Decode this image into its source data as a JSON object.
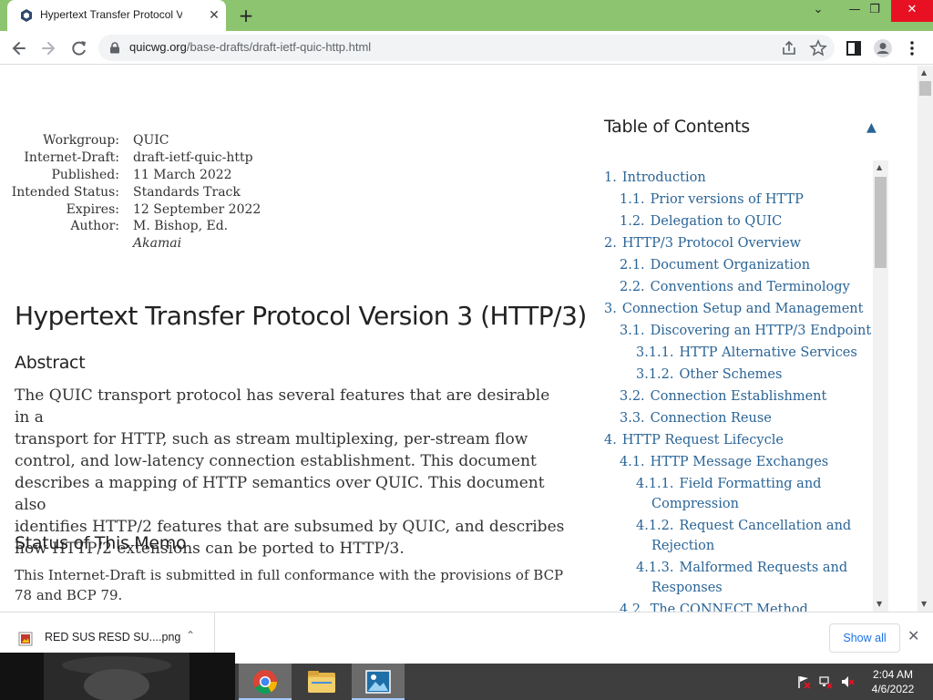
{
  "browser": {
    "tab_title": "Hypertext Transfer Protocol Versi",
    "url_domain": "quicwg.org",
    "url_path": "/base-drafts/draft-ietf-quic-http.html"
  },
  "document": {
    "meta": [
      {
        "label": "Workgroup:",
        "value": "QUIC"
      },
      {
        "label": "Internet-Draft:",
        "value": "draft-ietf-quic-http"
      },
      {
        "label": "Published:",
        "value": "11 March 2022"
      },
      {
        "label": "Intended Status:",
        "value": "Standards Track"
      },
      {
        "label": "Expires:",
        "value": "12 September 2022"
      },
      {
        "label": "Author:",
        "value": "M. Bishop, Ed."
      }
    ],
    "author_org": "Akamai",
    "title": "Hypertext Transfer Protocol Version 3 (HTTP/3)",
    "abstract_heading": "Abstract",
    "abstract_lines": [
      "The QUIC transport protocol has several features that are desirable in a",
      "transport for HTTP, such as stream multiplexing, per-stream flow",
      "control, and low-latency connection establishment. This document",
      "describes a mapping of HTTP semantics over QUIC. This document also",
      "identifies HTTP/2 features that are subsumed by QUIC, and describes",
      "how HTTP/2 extensions can be ported to HTTP/3."
    ],
    "status_heading": "Status of This Memo",
    "status_lines": [
      "This Internet-Draft is submitted in full conformance with the provisions of BCP",
      "78 and BCP 79."
    ]
  },
  "toc": {
    "title": "Table of Contents",
    "toggle": "▲",
    "items": [
      {
        "num": "1.",
        "label": "Introduction",
        "level": 0
      },
      {
        "num": "1.1.",
        "label": "Prior versions of HTTP",
        "level": 1
      },
      {
        "num": "1.2.",
        "label": "Delegation to QUIC",
        "level": 1
      },
      {
        "num": "2.",
        "label": "HTTP/3 Protocol Overview",
        "level": 0
      },
      {
        "num": "2.1.",
        "label": "Document Organization",
        "level": 1
      },
      {
        "num": "2.2.",
        "label": "Conventions and Terminology",
        "level": 1
      },
      {
        "num": "3.",
        "label": "Connection Setup and Management",
        "level": 0
      },
      {
        "num": "3.1.",
        "label": "Discovering an HTTP/3 Endpoint",
        "level": 1
      },
      {
        "num": "3.1.1.",
        "label": "HTTP Alternative Services",
        "level": 2
      },
      {
        "num": "3.1.2.",
        "label": "Other Schemes",
        "level": 2
      },
      {
        "num": "3.2.",
        "label": "Connection Establishment",
        "level": 1
      },
      {
        "num": "3.3.",
        "label": "Connection Reuse",
        "level": 1
      },
      {
        "num": "4.",
        "label": "HTTP Request Lifecycle",
        "level": 0
      },
      {
        "num": "4.1.",
        "label": "HTTP Message Exchanges",
        "level": 1
      },
      {
        "num": "4.1.1.",
        "label": "Field Formatting and",
        "cont": "Compression",
        "level": 2
      },
      {
        "num": "4.1.2.",
        "label": "Request Cancellation and",
        "cont": "Rejection",
        "level": 2
      },
      {
        "num": "4.1.3.",
        "label": "Malformed Requests and",
        "cont": "Responses",
        "level": 2
      },
      {
        "num": "4.2.",
        "label": "The CONNECT Method",
        "level": 1
      }
    ]
  },
  "downloads": {
    "file_name": "RED SUS RESD SU....png",
    "show_all": "Show all"
  },
  "taskbar": {
    "time": "2:04 AM",
    "date": "4/6/2022"
  }
}
